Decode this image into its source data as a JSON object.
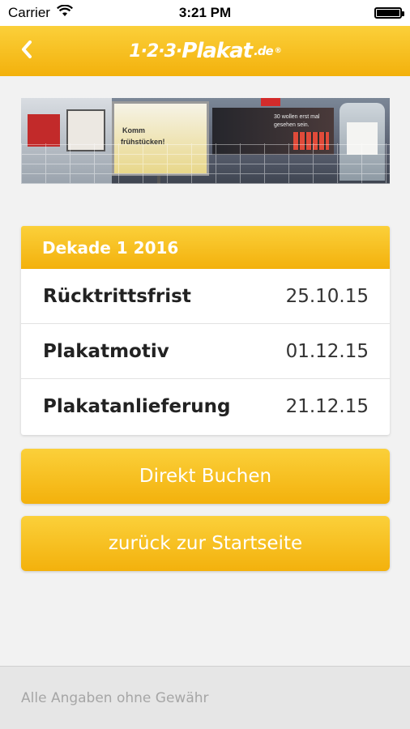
{
  "status_bar": {
    "carrier": "Carrier",
    "time": "3:21 PM",
    "wifi_icon": "wifi-icon",
    "battery_icon": "battery-icon"
  },
  "nav": {
    "back_icon": "chevron-left-icon",
    "logo_numbers": "1·2·3·",
    "logo_word": "Plakat",
    "logo_tld": ".de",
    "logo_reg": "®"
  },
  "banner": {
    "poster_text_1": "Komm",
    "poster_text_2": "frühstücken!",
    "billboard_text_1": "30 wollen erst mal",
    "billboard_text_2": "gesehen sein."
  },
  "card": {
    "header": "Dekade 1 2016",
    "rows": [
      {
        "label": "Rücktrittsfrist",
        "value": "25.10.15"
      },
      {
        "label": "Plakatmotiv",
        "value": "01.12.15"
      },
      {
        "label": "Plakatanlieferung",
        "value": "21.12.15"
      }
    ]
  },
  "buttons": {
    "book": "Direkt Buchen",
    "home": "zurück zur Startseite"
  },
  "footer": {
    "disclaimer": "Alle Angaben ohne Gewähr"
  },
  "colors": {
    "accent_top": "#fbd03a",
    "accent_bottom": "#f3b10c",
    "background": "#f2f2f2"
  }
}
